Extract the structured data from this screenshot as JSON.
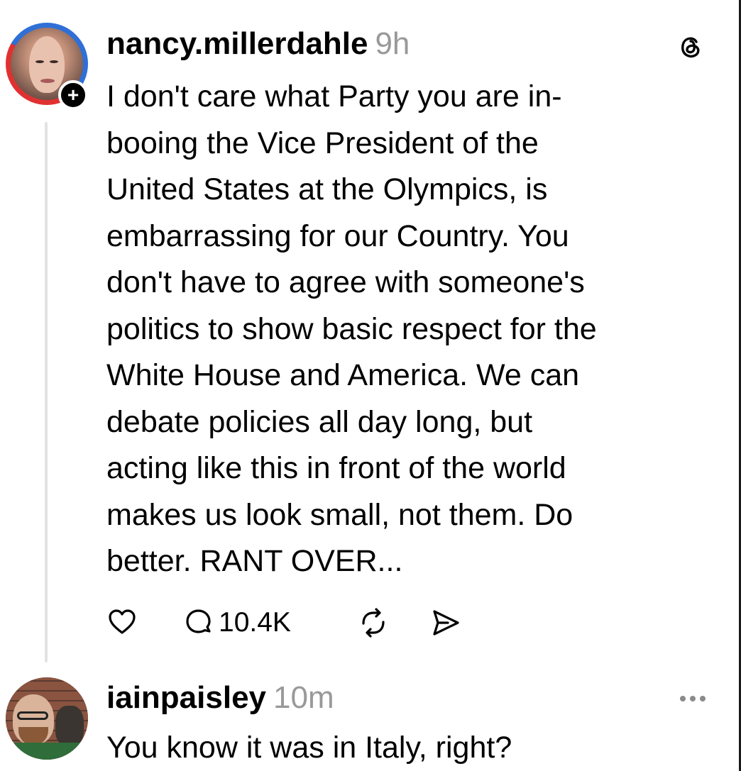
{
  "post": {
    "username": "nancy.millerdahle",
    "time": "9h",
    "avatar_badge": "+",
    "text_lines": [
      "I don't care what Party you are in-",
      "booing the Vice President of the",
      "United States at the Olympics, is",
      "embarrassing for our Country. You",
      "don't have to agree with someone's",
      "politics to show basic respect for the",
      "White House and America. We can",
      "debate policies all day long, but",
      "acting like this in front of the world",
      "makes us look small, not them. Do",
      "better. RANT OVER..."
    ],
    "reply_count": "10.4K",
    "icons": {
      "logo": "threads-logo-icon",
      "like": "heart-icon",
      "reply": "comment-icon",
      "repost": "repost-icon",
      "share": "send-icon"
    }
  },
  "reply": {
    "username": "iainpaisley",
    "time": "10m",
    "text": "You know it was in Italy, right?",
    "icons": {
      "more": "more-options-icon"
    }
  },
  "colors": {
    "text": "#000000",
    "muted": "#999999",
    "thread_line": "#e2e2e2",
    "ring_blue": "#2f6fd6",
    "ring_red": "#e03131"
  }
}
